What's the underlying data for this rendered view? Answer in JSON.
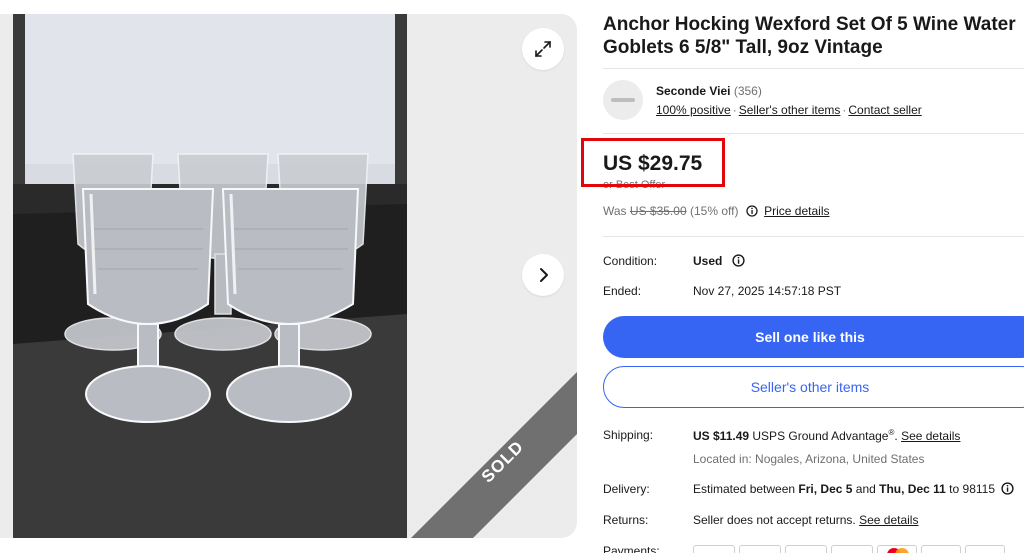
{
  "gallery": {
    "sold_label": "SOLD",
    "expand_icon": "expand-icon",
    "next_icon": "chevron-right-icon"
  },
  "listing": {
    "title": "Anchor Hocking Wexford Set Of 5 Wine Water Goblets 6 5/8\" Tall, 9oz Vintage"
  },
  "seller": {
    "name": "Seconde Viei",
    "feedback_count": "(356)",
    "positive": "100% positive",
    "other_items_link": "Seller's other items",
    "contact_link": "Contact seller"
  },
  "pricing": {
    "price": "US $29.75",
    "best_offer": "or Best Offer",
    "was_label": "Was",
    "was_price": "US $35.00",
    "discount": "(15% off)",
    "price_details_link": "Price details"
  },
  "details": {
    "condition_label": "Condition:",
    "condition_value": "Used",
    "ended_label": "Ended:",
    "ended_value": "Nov 27, 2025 14:57:18 PST"
  },
  "actions": {
    "sell_one_label": "Sell one like this",
    "other_items_label": "Seller's other items"
  },
  "shipping": {
    "label": "Shipping:",
    "price": "US $11.49",
    "service": "USPS Ground Advantage",
    "registered": "®",
    "details_link": "See details",
    "location": "Located in: Nogales, Arizona, United States"
  },
  "delivery": {
    "label": "Delivery:",
    "prefix": "Estimated between ",
    "start": "Fri, Dec 5",
    "and": " and ",
    "end": "Thu, Dec 11",
    "suffix": " to 98115"
  },
  "returns": {
    "label": "Returns:",
    "text": "Seller does not accept returns. ",
    "details_link": "See details"
  },
  "payments": {
    "label": "Payments:",
    "cards": [
      "paypal-card",
      "gpay-card",
      "applepay-card",
      "visa-card",
      "mastercard-card",
      "discover-card",
      "diners-card"
    ]
  },
  "colors": {
    "accent_blue": "#3665f3",
    "highlight_red": "#e0060b",
    "sold_ribbon": "#707070"
  }
}
